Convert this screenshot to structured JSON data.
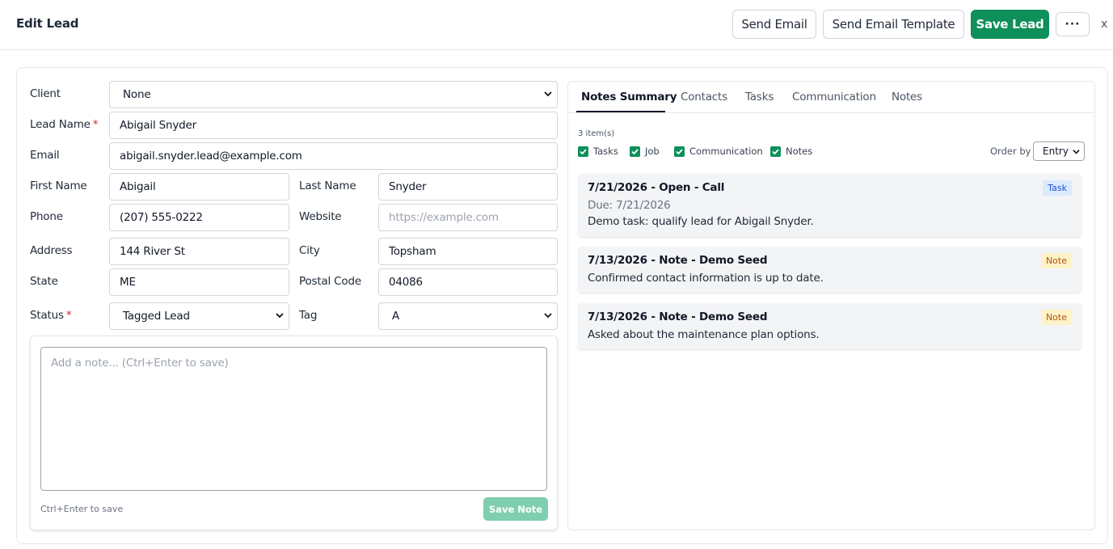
{
  "header": {
    "title": "Edit Lead",
    "send_email": "Send Email",
    "send_email_template": "Send Email Template",
    "save_lead": "Save Lead",
    "more": "···",
    "close": "x"
  },
  "form": {
    "client": {
      "label": "Client",
      "value": "None"
    },
    "lead_name": {
      "label": "Lead Name",
      "required": "*",
      "value": "Abigail Snyder"
    },
    "email": {
      "label": "Email",
      "value": "abigail.snyder.lead@example.com"
    },
    "first_name": {
      "label": "First Name",
      "value": "Abigail"
    },
    "last_name": {
      "label": "Last Name",
      "value": "Snyder"
    },
    "phone": {
      "label": "Phone",
      "value": "(207) 555-0222"
    },
    "website": {
      "label": "Website",
      "value": "",
      "placeholder": "https://example.com"
    },
    "address": {
      "label": "Address",
      "value": "144 River St"
    },
    "city": {
      "label": "City",
      "value": "Topsham"
    },
    "state": {
      "label": "State",
      "value": "ME"
    },
    "postal_code": {
      "label": "Postal Code",
      "value": "04086"
    },
    "status": {
      "label": "Status",
      "required": "*",
      "value": "Tagged Lead"
    },
    "tag": {
      "label": "Tag",
      "value": "A"
    }
  },
  "note_editor": {
    "placeholder": "Add a note... (Ctrl+Enter to save)",
    "hint": "Ctrl+Enter to save",
    "save_label": "Save Note"
  },
  "tabs": [
    {
      "label": "Notes Summary",
      "active": true
    },
    {
      "label": "Contacts",
      "active": false
    },
    {
      "label": "Tasks",
      "active": false
    },
    {
      "label": "Communication",
      "active": false
    },
    {
      "label": "Notes",
      "active": false
    }
  ],
  "summary": {
    "count": "3 item(s)",
    "filters": [
      {
        "label": "Tasks",
        "checked": true
      },
      {
        "label": "Job",
        "checked": true
      },
      {
        "label": "Communication",
        "checked": true
      },
      {
        "label": "Notes",
        "checked": true
      }
    ],
    "order_by_label": "Order by",
    "order_by_value": "Entry",
    "items": [
      {
        "title": "7/21/2026 - Open - Call",
        "sub": "Due: 7/21/2026",
        "body": "Demo task: qualify lead for Abigail Snyder.",
        "badge": "Task"
      },
      {
        "title": "7/13/2026 - Note - Demo Seed",
        "body": "Confirmed contact information is up to date.",
        "badge": "Note"
      },
      {
        "title": "7/13/2026 - Note - Demo Seed",
        "body": "Asked about the maintenance plan options.",
        "badge": "Note"
      }
    ]
  },
  "colors": {
    "primary": "#0f8f5a",
    "primary_disabled": "#7fcfae",
    "required": "#dc2626",
    "task_badge_bg": "#dbeafe",
    "note_badge_bg": "#fef3c7"
  }
}
